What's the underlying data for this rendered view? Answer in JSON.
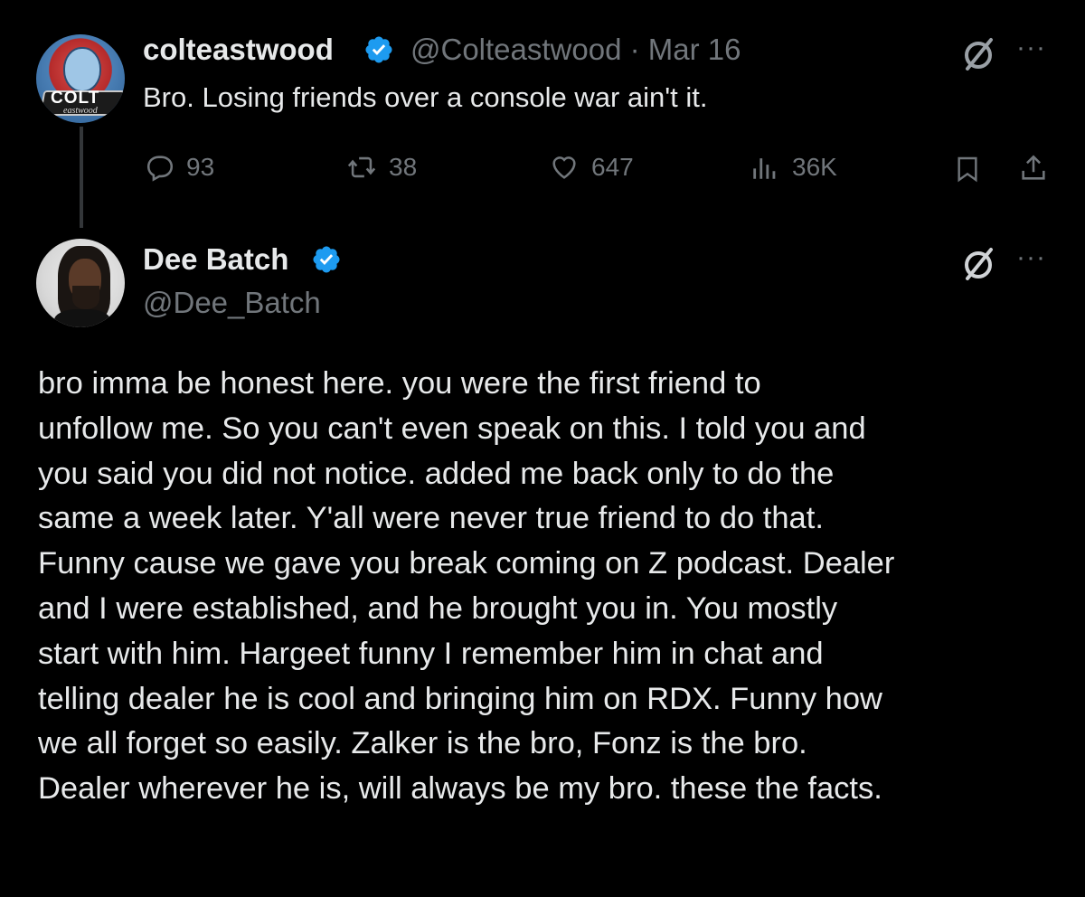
{
  "parent_tweet": {
    "author_name": "colteastwood",
    "author_handle": "@Colteastwood",
    "separator": "·",
    "date": "Mar 16",
    "avatar_text": "COLT",
    "avatar_subtext": "eastwood",
    "text": "Bro. Losing friends over a console war ain't it.",
    "replies": "93",
    "reposts": "38",
    "likes": "647",
    "views": "36K",
    "more_label": "···"
  },
  "reply_tweet": {
    "author_name": "Dee Batch",
    "author_handle": "@Dee_Batch",
    "more_label": "···",
    "lines": [
      "bro imma be honest here. you were the first friend to",
      "unfollow me. So you can't even speak on this. I told you and",
      "you said you did not notice. added me back only to do the",
      "same a week later. Y'all were never true friend to do that.",
      "Funny cause we gave you break coming on Z podcast. Dealer",
      "and I were established, and he brought you in. You mostly",
      "start with him. Hargeet funny I remember him in chat and",
      "telling dealer he is cool and bringing him on RDX. Funny how",
      "we all forget so easily. Zalker is the bro, Fonz is the bro.",
      "Dealer wherever he is, will always be my bro. these the facts."
    ]
  },
  "icons": {
    "verified": "verified-badge-icon",
    "grok": "grok-icon",
    "reply": "reply-icon",
    "repost": "repost-icon",
    "like": "heart-icon",
    "views": "views-icon",
    "bookmark": "bookmark-icon",
    "share": "share-icon"
  },
  "colors": {
    "background": "#000000",
    "text": "#e7e9ea",
    "muted": "#71767b",
    "verified": "#1d9bf0",
    "thread_line": "#333639"
  }
}
